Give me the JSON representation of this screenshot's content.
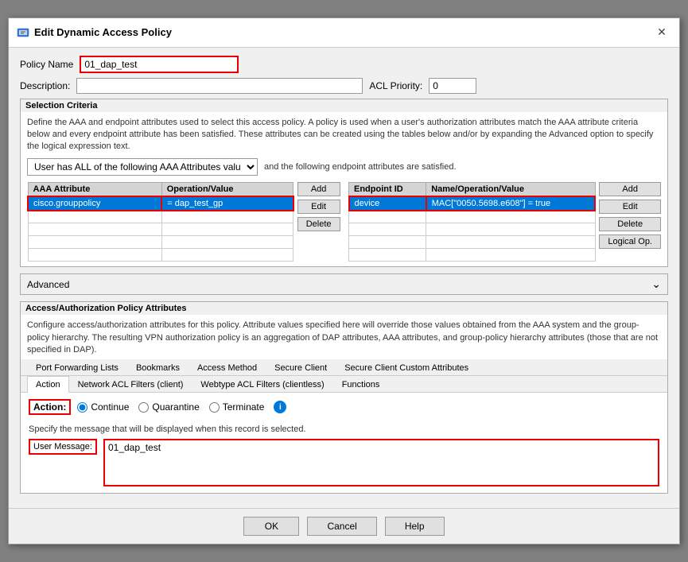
{
  "window": {
    "title": "Edit Dynamic Access Policy",
    "close_label": "✕"
  },
  "policy_name": {
    "label": "Policy Name",
    "value": "01_dap_test",
    "placeholder": ""
  },
  "description": {
    "label": "Description:",
    "value": "",
    "placeholder": ""
  },
  "acl_priority": {
    "label": "ACL Priority:",
    "value": "0"
  },
  "selection_criteria": {
    "title": "Selection Criteria",
    "description": "Define the AAA and endpoint attributes used to select this access policy. A policy is used when a user's authorization attributes match the AAA attribute criteria below and every endpoint attribute has been satisfied. These attributes can be created using the tables below and/or by expanding the Advanced option to specify the logical expression text.",
    "dropdown_label": "User has ALL of the following AAA Attributes values...",
    "and_text": "and the following endpoint attributes are satisfied.",
    "aaa_table": {
      "columns": [
        "AAA Attribute",
        "Operation/Value"
      ],
      "rows": [
        {
          "attribute": "cisco.grouppolicy",
          "operation": "= dap_test_gp",
          "selected": true
        }
      ],
      "empty_rows": 4
    },
    "endpoint_table": {
      "columns": [
        "Endpoint ID",
        "Name/Operation/Value"
      ],
      "rows": [
        {
          "id": "device",
          "value": "MAC[\"0050.5698.e608\"] = true",
          "selected": true
        }
      ],
      "empty_rows": 4
    },
    "aaa_buttons": [
      "Add",
      "Edit",
      "Delete"
    ],
    "endpoint_buttons": [
      "Add",
      "Edit",
      "Delete",
      "Logical Op."
    ]
  },
  "advanced": {
    "label": "Advanced",
    "chevron": "⌄"
  },
  "auth_policy": {
    "title": "Access/Authorization Policy Attributes",
    "description": "Configure access/authorization attributes for this policy. Attribute values specified here will override those values obtained from the AAA system and the group-policy hierarchy. The resulting VPN authorization policy is an aggregation of DAP attributes, AAA attributes, and group-policy hierarchy attributes (those that are not specified in DAP).",
    "tabs": [
      {
        "label": "Port Forwarding Lists",
        "active": false
      },
      {
        "label": "Bookmarks",
        "active": false
      },
      {
        "label": "Access Method",
        "active": false
      },
      {
        "label": "Secure Client",
        "active": false
      },
      {
        "label": "Secure Client Custom Attributes",
        "active": false
      },
      {
        "label": "Action",
        "active": true
      },
      {
        "label": "Network ACL Filters (client)",
        "active": false
      },
      {
        "label": "Webtype ACL Filters (clientless)",
        "active": false
      },
      {
        "label": "Functions",
        "active": false
      }
    ]
  },
  "action": {
    "label": "Action:",
    "options": [
      {
        "label": "Continue",
        "value": "continue",
        "checked": true
      },
      {
        "label": "Quarantine",
        "value": "quarantine",
        "checked": false
      },
      {
        "label": "Terminate",
        "value": "terminate",
        "checked": false
      }
    ]
  },
  "user_message": {
    "description": "Specify the message that will be displayed when this record is selected.",
    "label": "User Message:",
    "value": "01_dap_test"
  },
  "buttons": {
    "ok": "OK",
    "cancel": "Cancel",
    "help": "Help"
  }
}
